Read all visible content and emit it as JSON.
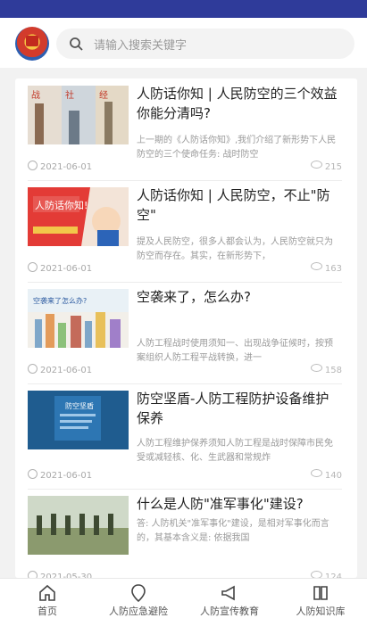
{
  "search": {
    "placeholder": "请输入搜索关键字"
  },
  "articles": [
    {
      "title": "人防话你知 | 人民防空的三个效益你能分清吗?",
      "summary": "上一期的《人防话你知》,我们介绍了新形势下人民防空的三个使命任务: 战时防空",
      "date": "2021-06-01",
      "views": "215",
      "thumb_text": ""
    },
    {
      "title": "人防话你知 | 人民防空，不止\"防空\"",
      "summary": "提及人民防空，很多人都会认为，人民防空就只为防空而存在。其实，在新形势下，",
      "date": "2021-06-01",
      "views": "163",
      "thumb_text": "人防话你知!"
    },
    {
      "title": "空袭来了，怎么办?",
      "summary": "人防工程战时使用须知一、出现战争征候时，按预案组织人防工程平战转换，进一",
      "date": "2021-06-01",
      "views": "158",
      "thumb_text": "空袭来了怎么办?"
    },
    {
      "title": "防空坚盾-人防工程防护设备维护保养",
      "summary": "人防工程维护保养须知人防工程是战时保障市民免受或减轻核、化、生武器和常规炸",
      "date": "2021-06-01",
      "views": "140",
      "thumb_text": "防空坚盾"
    },
    {
      "title": "什么是人防\"准军事化\"建设?",
      "summary": "答: 人防机关\"准军事化\"建设，是相对军事化而言的，其基本含义是: 依据我国",
      "date": "2021-05-30",
      "views": "124",
      "thumb_text": ""
    }
  ],
  "nav": [
    {
      "label": "首页"
    },
    {
      "label": "人防应急避险"
    },
    {
      "label": "人防宣传教育"
    },
    {
      "label": "人防知识库"
    }
  ],
  "colors": {
    "statusbar": "#2f3b9a",
    "accent": "#e23d3d"
  }
}
